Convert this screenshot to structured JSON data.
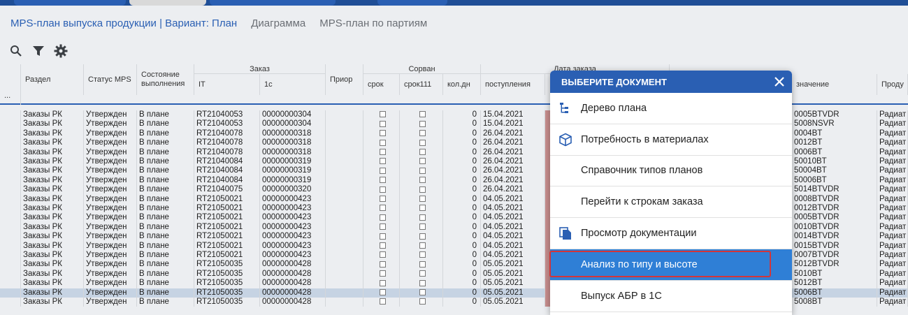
{
  "header": {
    "tabs": [
      {
        "label": "MPS-план выпуска продукции | Вариант: План"
      },
      {
        "label": "Диаграмма"
      },
      {
        "label": "MPS-план по партиям"
      }
    ]
  },
  "toolbar": {
    "icons": [
      "search-icon",
      "filter-icon",
      "gear-icon"
    ]
  },
  "table": {
    "headers": {
      "razdel": "Раздел",
      "status": "Статус MPS",
      "sostoyanie": "Состояние выполнения",
      "zakaz_group": "Заказ",
      "it": "IT",
      "c1": "1с",
      "prio": "Приор",
      "sorvan_group": "Сорван",
      "srok": "срок",
      "srok111": "срок111",
      "koldn": "кол.дн",
      "data_group": "Дата заказа",
      "postupleniya": "поступления",
      "oboznachenie": "значение",
      "produkt": "Проду",
      "menu_dots": "..."
    },
    "rows": [
      {
        "razdel": "Заказы РК",
        "status": "Утвержден",
        "state": "В плане",
        "it": "RT21040053",
        "c1": "00000000304",
        "kol": "0",
        "date": "15.04.2021",
        "obozn": "0005BTVDR",
        "prod": "Радиат"
      },
      {
        "razdel": "Заказы РК",
        "status": "Утвержден",
        "state": "В плане",
        "it": "RT21040053",
        "c1": "00000000304",
        "kol": "0",
        "date": "15.04.2021",
        "obozn": "5008NSVR",
        "prod": "Радиат"
      },
      {
        "razdel": "Заказы РК",
        "status": "Утвержден",
        "state": "В плане",
        "it": "RT21040078",
        "c1": "00000000318",
        "kol": "0",
        "date": "26.04.2021",
        "obozn": "0004BT",
        "prod": "Радиат"
      },
      {
        "razdel": "Заказы РК",
        "status": "Утвержден",
        "state": "В плане",
        "it": "RT21040078",
        "c1": "00000000318",
        "kol": "0",
        "date": "26.04.2021",
        "obozn": "0012BT",
        "prod": "Радиат"
      },
      {
        "razdel": "Заказы РК",
        "status": "Утвержден",
        "state": "В плане",
        "it": "RT21040078",
        "c1": "00000000318",
        "kol": "0",
        "date": "26.04.2021",
        "obozn": "0006BT",
        "prod": "Радиат"
      },
      {
        "razdel": "Заказы РК",
        "status": "Утвержден",
        "state": "В плане",
        "it": "RT21040084",
        "c1": "00000000319",
        "kol": "0",
        "date": "26.04.2021",
        "obozn": "50010BT",
        "prod": "Радиат"
      },
      {
        "razdel": "Заказы РК",
        "status": "Утвержден",
        "state": "В плане",
        "it": "RT21040084",
        "c1": "00000000319",
        "kol": "0",
        "date": "26.04.2021",
        "obozn": "50004BT",
        "prod": "Радиат"
      },
      {
        "razdel": "Заказы РК",
        "status": "Утвержден",
        "state": "В плане",
        "it": "RT21040084",
        "c1": "00000000319",
        "kol": "0",
        "date": "26.04.2021",
        "obozn": "50006BT",
        "prod": "Радиат"
      },
      {
        "razdel": "Заказы РК",
        "status": "Утвержден",
        "state": "В плане",
        "it": "RT21040075",
        "c1": "00000000320",
        "kol": "0",
        "date": "26.04.2021",
        "obozn": "5014BTVDR",
        "prod": "Радиат"
      },
      {
        "razdel": "Заказы РК",
        "status": "Утвержден",
        "state": "В плане",
        "it": "RT21050021",
        "c1": "00000000423",
        "kol": "0",
        "date": "04.05.2021",
        "obozn": "0008BTVDR",
        "prod": "Радиат"
      },
      {
        "razdel": "Заказы РК",
        "status": "Утвержден",
        "state": "В плане",
        "it": "RT21050021",
        "c1": "00000000423",
        "kol": "0",
        "date": "04.05.2021",
        "obozn": "0012BTVDR",
        "prod": "Радиат"
      },
      {
        "razdel": "Заказы РК",
        "status": "Утвержден",
        "state": "В плане",
        "it": "RT21050021",
        "c1": "00000000423",
        "kol": "0",
        "date": "04.05.2021",
        "obozn": "0005BTVDR",
        "prod": "Радиат"
      },
      {
        "razdel": "Заказы РК",
        "status": "Утвержден",
        "state": "В плане",
        "it": "RT21050021",
        "c1": "00000000423",
        "kol": "0",
        "date": "04.05.2021",
        "obozn": "0010BTVDR",
        "prod": "Радиат"
      },
      {
        "razdel": "Заказы РК",
        "status": "Утвержден",
        "state": "В плане",
        "it": "RT21050021",
        "c1": "00000000423",
        "kol": "0",
        "date": "04.05.2021",
        "obozn": "0014BTVDR",
        "prod": "Радиат"
      },
      {
        "razdel": "Заказы РК",
        "status": "Утвержден",
        "state": "В плане",
        "it": "RT21050021",
        "c1": "00000000423",
        "kol": "0",
        "date": "04.05.2021",
        "obozn": "0015BTVDR",
        "prod": "Радиат"
      },
      {
        "razdel": "Заказы РК",
        "status": "Утвержден",
        "state": "В плане",
        "it": "RT21050021",
        "c1": "00000000423",
        "kol": "0",
        "date": "04.05.2021",
        "obozn": "0007BTVDR",
        "prod": "Радиат"
      },
      {
        "razdel": "Заказы РК",
        "status": "Утвержден",
        "state": "В плане",
        "it": "RT21050035",
        "c1": "00000000428",
        "kol": "0",
        "date": "05.05.2021",
        "obozn": "5012BTVDR",
        "prod": "Радиат"
      },
      {
        "razdel": "Заказы РК",
        "status": "Утвержден",
        "state": "В плане",
        "it": "RT21050035",
        "c1": "00000000428",
        "kol": "0",
        "date": "05.05.2021",
        "obozn": "5010BT",
        "prod": "Радиат"
      },
      {
        "razdel": "Заказы РК",
        "status": "Утвержден",
        "state": "В плане",
        "it": "RT21050035",
        "c1": "00000000428",
        "kol": "0",
        "date": "05.05.2021",
        "obozn": "5012BT",
        "prod": "Радиат"
      },
      {
        "razdel": "Заказы РК",
        "status": "Утвержден",
        "state": "В плане",
        "it": "RT21050035",
        "c1": "00000000428",
        "kol": "0",
        "date": "05.05.2021",
        "obozn": "5006BT",
        "prod": "Радиат",
        "selected": true
      },
      {
        "razdel": "Заказы РК",
        "status": "Утвержден",
        "state": "В плане",
        "it": "RT21050035",
        "c1": "00000000428",
        "kol": "0",
        "date": "05.05.2021",
        "obozn": "5008BT",
        "prod": "Радиат"
      }
    ]
  },
  "dialog": {
    "title": "ВЫБЕРИТЕ ДОКУМЕНТ",
    "items": [
      {
        "label": "Дерево плана",
        "icon": "tree-icon"
      },
      {
        "label": "Потребность в материалах",
        "icon": "cube-icon"
      },
      {
        "label": "Справочник типов планов",
        "icon": ""
      },
      {
        "label": "Перейти к строкам заказа",
        "icon": ""
      },
      {
        "label": "Просмотр документации",
        "icon": "documents-icon"
      },
      {
        "label": "Анализ по типу и высоте",
        "icon": "",
        "active": true
      },
      {
        "label": "Выпуск АБР в 1С",
        "icon": ""
      }
    ]
  },
  "colors": {
    "accent": "#2a5fb3",
    "menu_active": "#2f7fd6",
    "highlight_border": "#d2353a",
    "overdue_cell": "#c98f8f"
  }
}
